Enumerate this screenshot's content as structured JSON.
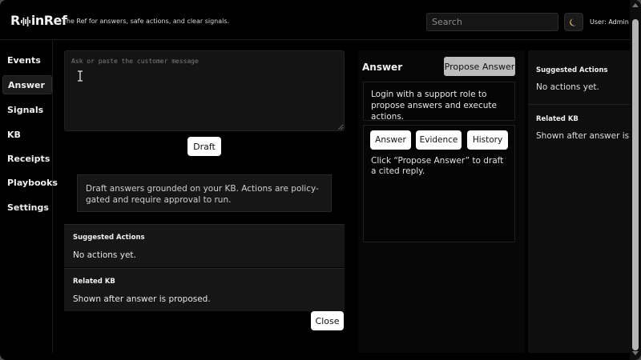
{
  "header": {
    "logo_text_left": "R",
    "logo_text_right": "inRef",
    "tagline": "The Ref for answers, safe actions, and clear signals.",
    "search_placeholder": "Search",
    "theme_icon": "moon-icon",
    "user_label": "User: Admin"
  },
  "sidebar": {
    "items": [
      {
        "label": "Events"
      },
      {
        "label": "Answer",
        "active": true
      },
      {
        "label": "Signals"
      },
      {
        "label": "KB"
      },
      {
        "label": "Receipts"
      },
      {
        "label": "Playbooks"
      },
      {
        "label": "Settings"
      }
    ]
  },
  "composer": {
    "placeholder": "Ask or paste the customer message",
    "draft_label": "Draft"
  },
  "info": {
    "text": "Draft answers grounded on your KB. Actions are policy-gated and require approval to run."
  },
  "suggested_actions": {
    "title": "Suggested Actions",
    "body": "No actions yet."
  },
  "related_kb": {
    "title": "Related KB",
    "body": "Shown after answer is proposed."
  },
  "close_label": "Close",
  "answer": {
    "title": "Answer",
    "propose_label": "Propose Answer",
    "notice": "Login with a support role to propose answers and execute actions.",
    "tabs": [
      {
        "label": "Answer"
      },
      {
        "label": "Evidence"
      },
      {
        "label": "History"
      }
    ],
    "hint": "Click “Propose Answer” to draft a cited reply."
  },
  "right_panel": {
    "actions_title": "Suggested Actions",
    "actions_body": "No actions yet.",
    "kb_title": "Related KB",
    "kb_body": "Shown after answer is proposed."
  },
  "colors": {
    "background": "#000000",
    "panel": "#161616",
    "button": "#ffffff",
    "button_muted": "#bdbdbd"
  }
}
